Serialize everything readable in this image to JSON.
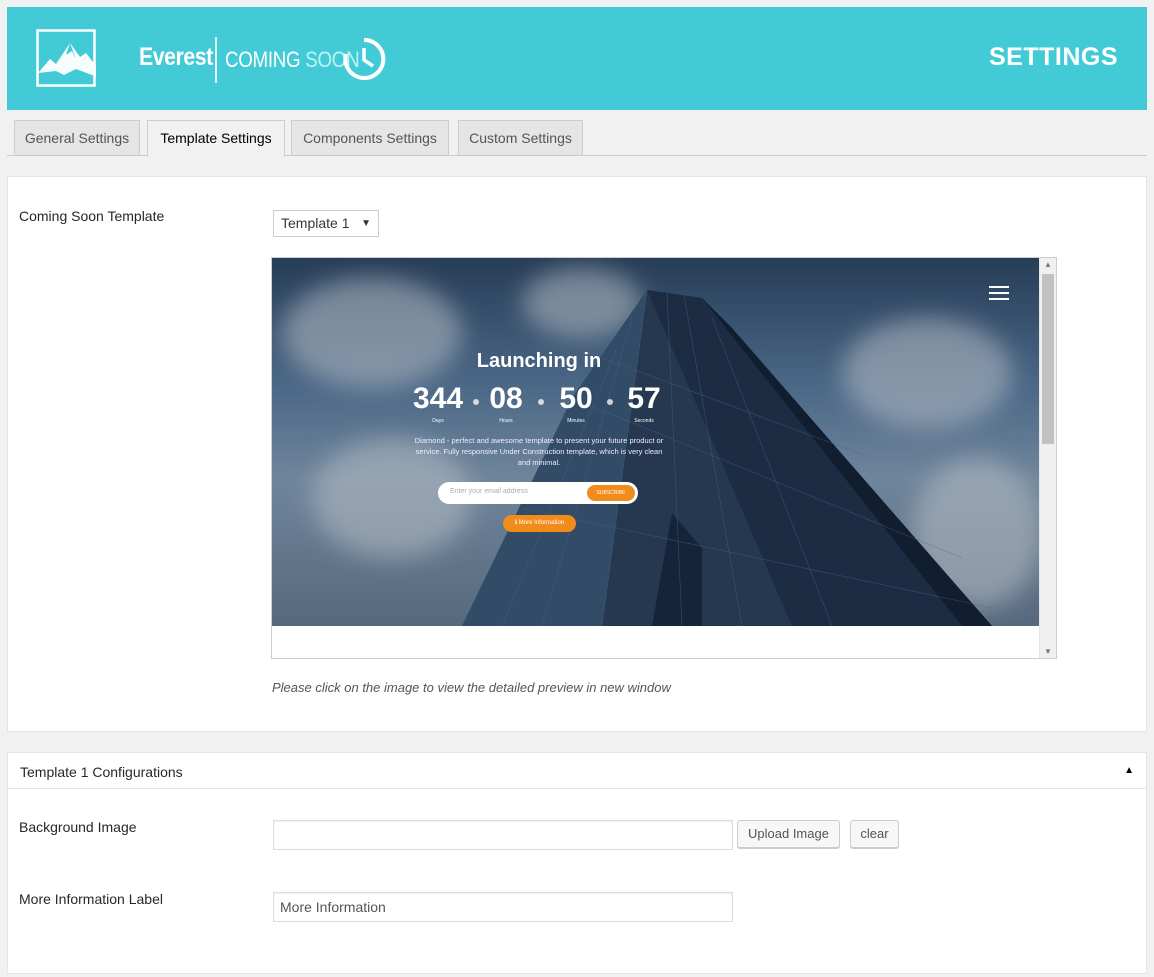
{
  "header": {
    "brand": "Everest",
    "product_a": "COMING ",
    "product_b": "SOON",
    "title": "SETTINGS",
    "bg_color": "#42cbd7"
  },
  "tabs": [
    {
      "label": "General Settings",
      "active": false
    },
    {
      "label": "Template Settings",
      "active": true
    },
    {
      "label": "Components Settings",
      "active": false
    },
    {
      "label": "Custom Settings",
      "active": false
    }
  ],
  "template_panel": {
    "label": "Coming Soon Template",
    "select_value": "Template 1",
    "caption": "Please click on the image to view the detailed preview in new window",
    "preview": {
      "title": "Launching in",
      "countdown": [
        {
          "value": "344",
          "unit": "Days"
        },
        {
          "value": "08",
          "unit": "Hours"
        },
        {
          "value": "50",
          "unit": "Minutes"
        },
        {
          "value": "57",
          "unit": "Seconds"
        }
      ],
      "description": "Diamond - perfect and awesome template to present your future product or service. Fully responsive Under Construction template, which is very clean and minimal.",
      "email_placeholder": "Enter your email address",
      "subscribe_label": "SUBSCRIBE",
      "more_info_label": "More Information",
      "accent_color": "#f18b1c"
    }
  },
  "config_panel": {
    "title": "Template 1 Configurations",
    "toggle_icon": "caret-up-icon",
    "background_image": {
      "label": "Background Image",
      "value": "",
      "upload_label": "Upload Image",
      "clear_label": "clear"
    },
    "more_info": {
      "label": "More Information Label",
      "value": "More Information"
    }
  }
}
